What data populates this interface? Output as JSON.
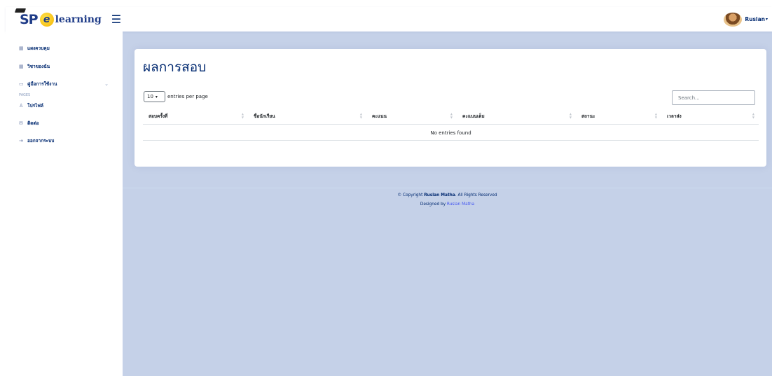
{
  "header": {
    "logo_sp": "SP",
    "logo_e": "e",
    "logo_text": "learning",
    "toggle_icon": "☰",
    "user_name": "Ruslan"
  },
  "sidebar": {
    "items": [
      {
        "icon": "grid-icon",
        "label": "แผงควบคุม"
      },
      {
        "icon": "grid-icon",
        "label": "วิชาของฉัน"
      },
      {
        "icon": "book-icon",
        "label": "คู่มือการใช้งาน"
      }
    ],
    "heading": "PAGES",
    "pages": [
      {
        "icon": "person-icon",
        "label": "โปรไฟล์"
      },
      {
        "icon": "envelope-icon",
        "label": "ติดต่อ"
      },
      {
        "icon": "logout-icon",
        "label": "ออกจากระบบ"
      }
    ]
  },
  "main": {
    "title": "ผลการสอบ",
    "length_value": "10",
    "length_label": "entries per page",
    "search_placeholder": "Search...",
    "columns": [
      "สอบครั้งที่",
      "ชื่อนักเรียน",
      "คะแนน",
      "คะแนนเต็ม",
      "สถานะ",
      "เวลาส่ง"
    ],
    "empty_message": "No entries found"
  },
  "footer": {
    "copyright_prefix": "© Copyright ",
    "brand": "Ruslan Matha",
    "copyright_suffix": ". All Rights Reserved",
    "designed_by": "Designed by ",
    "designer": "Ruslan Matha"
  }
}
